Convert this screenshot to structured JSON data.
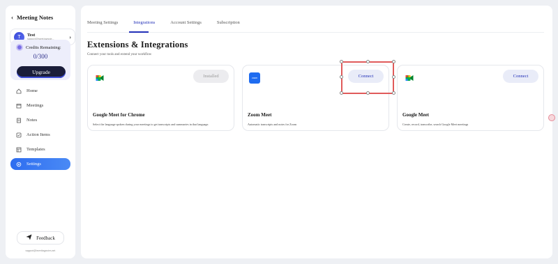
{
  "sidebar": {
    "title": "Meeting Notes",
    "user": {
      "initial": "T",
      "name": "Test",
      "email": "support@meetingnote..."
    },
    "credits": {
      "label": "Credits Remaining:",
      "value": "0/300"
    },
    "upgrade_label": "Upgrade",
    "nav": [
      {
        "label": "Home",
        "icon": "home-icon"
      },
      {
        "label": "Meetings",
        "icon": "calendar-icon"
      },
      {
        "label": "Notes",
        "icon": "note-icon"
      },
      {
        "label": "Action Items",
        "icon": "checklist-icon"
      },
      {
        "label": "Templates",
        "icon": "template-icon"
      },
      {
        "label": "Settings",
        "icon": "gear-icon"
      }
    ],
    "active_nav": "Settings",
    "feedback_label": "Feedback",
    "support_email": "support@meetingnotes.net"
  },
  "main": {
    "tabs": [
      "Meeting Settings",
      "Integrations",
      "Account Settings",
      "Subscription"
    ],
    "active_tab": "Integrations",
    "heading": "Extensions & Integrations",
    "subheading": "Connect your tools and extend your workflow",
    "cards": [
      {
        "name": "Google Meet for Chrome",
        "desc": "Select the language spoken during your meetings to get transcripts and summaries in that language.",
        "button": "Installed",
        "logo": "google-meet-icon"
      },
      {
        "name": "Zoom Meet",
        "desc": "Automatic transcripts and notes for Zoom",
        "button": "Connect",
        "logo": "zoom-icon"
      },
      {
        "name": "Google Meet",
        "desc": "Create, record, transcribe, search Google Meet meetings",
        "button": "Connect",
        "logo": "google-meet-icon"
      }
    ]
  },
  "colors": {
    "accent": "#2230b8",
    "active_nav": "#2e6df0",
    "highlight": "#e05a5a"
  }
}
